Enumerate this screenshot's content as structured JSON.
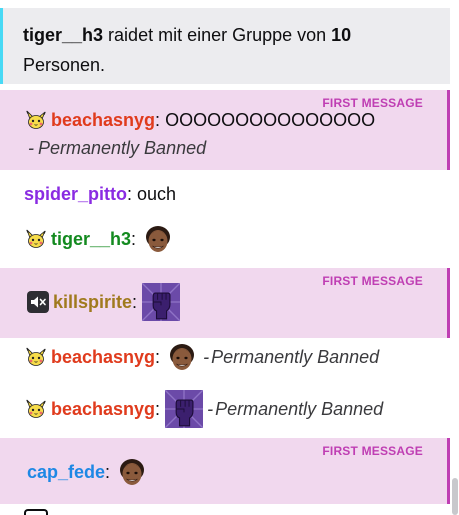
{
  "raid": {
    "user": "tiger__h3",
    "text_before": " raidet mit einer Gruppe von ",
    "count": "10",
    "text_after": " Personen."
  },
  "first_message_label": "FIRST MESSAGE",
  "colors": {
    "first_message_bg": "#f1d8ee",
    "first_message_accent": "#bf3eb3",
    "raid_accent": "#48d9f5",
    "beachasnyg": "#e03b1d",
    "spider_pitto": "#8a2be2",
    "tiger_h3": "#138a1f",
    "killspirite": "#a07a1e",
    "cap_fede": "#1e88e5"
  },
  "messages": [
    {
      "user": "beachasnyg",
      "colon": ":",
      "text": "OOOOOOOOOOOOOOO",
      "ban": "Permanently Banned",
      "first": true,
      "badge": "pichu-badge-icon"
    },
    {
      "user": "spider_pitto",
      "colon": ":",
      "text": "ouch"
    },
    {
      "user": "tiger__h3",
      "colon": ":",
      "badge": "pichu-badge-icon",
      "emote": "face-emote-icon"
    },
    {
      "user": "killspirite",
      "colon": ":",
      "first": true,
      "badge": "muted-speaker-badge-icon",
      "emote": "raised-fist-emote-icon"
    },
    {
      "user": "beachasnyg",
      "colon": ":",
      "badge": "pichu-badge-icon",
      "emote": "face-emote-icon",
      "dash": "-",
      "ban": "Permanently Banned"
    },
    {
      "user": "beachasnyg",
      "colon": ":",
      "badge": "pichu-badge-icon",
      "emote": "raised-fist-emote-icon",
      "dash": "-",
      "ban": "Permanently Banned"
    },
    {
      "user": "cap_fede",
      "colon": ":",
      "first": true,
      "emote": "face-emote-icon"
    }
  ],
  "ban_dash": "-"
}
